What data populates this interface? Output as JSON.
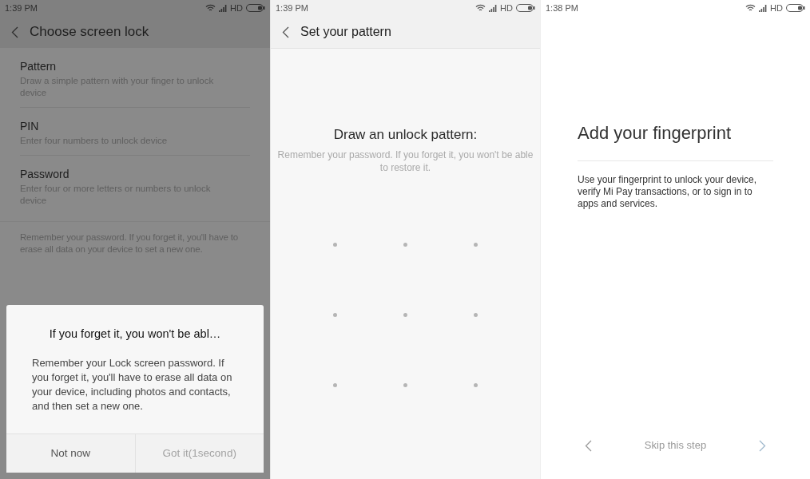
{
  "screens": [
    {
      "kind": "lock_menu",
      "status_bar": {
        "time": "1:39 PM",
        "network": "HD"
      },
      "title": "Choose screen lock",
      "options": [
        {
          "name": "Pattern",
          "description": "Draw a simple pattern with your finger to unlock device"
        },
        {
          "name": "PIN",
          "description": "Enter four numbers to unlock device"
        },
        {
          "name": "Password",
          "description": "Enter four or more letters or numbers to unlock device"
        }
      ],
      "note": "Remember your password. If you forget it, you'll have to erase all data on your device to set a new one.",
      "dialog": {
        "title": "If you forget it, you won't be abl…",
        "message": "Remember your Lock screen password. If you forget it, you'll have to erase all data on your device, including photos and contacts, and then set a new one.",
        "buttons": [
          {
            "label": "Not now",
            "disabled": false
          },
          {
            "label": "Got it(1second)",
            "disabled": true
          }
        ]
      }
    },
    {
      "kind": "pattern",
      "status_bar": {
        "time": "1:39 PM",
        "network": "HD"
      },
      "title": "Set your pattern",
      "heading": "Draw an unlock pattern:",
      "hint": "Remember your password. If you forget it, you won't be able to restore it."
    },
    {
      "kind": "fingerprint",
      "status_bar": {
        "time": "1:38 PM",
        "network": "HD"
      },
      "heading": "Add your fingerprint",
      "body": "Use your fingerprint to unlock your device, verify Mi Pay transactions, or to sign in to apps and services.",
      "skip": "Skip this step"
    }
  ]
}
